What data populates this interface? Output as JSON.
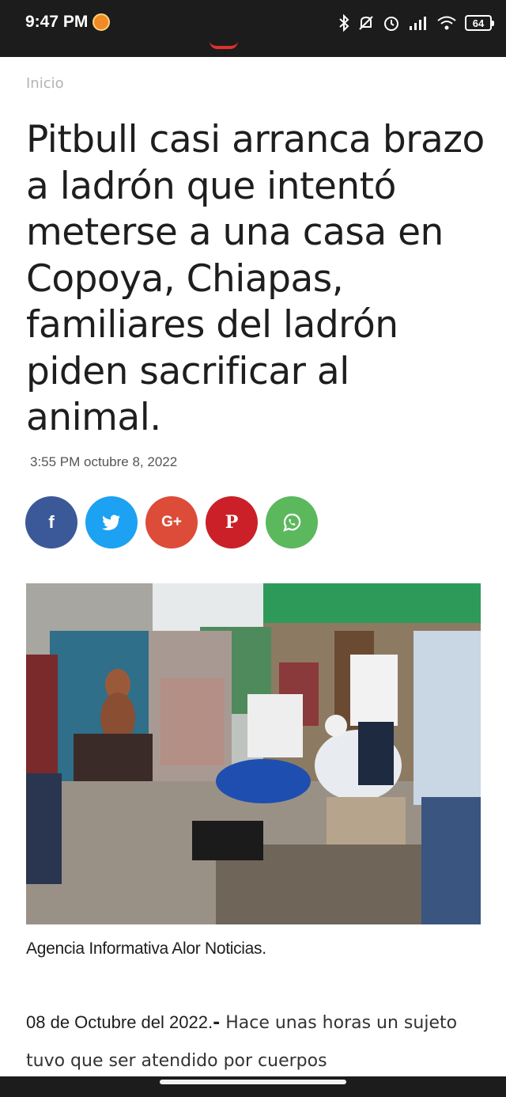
{
  "status_bar": {
    "time": "9:47 PM",
    "battery": "64",
    "icons": [
      "bluetooth-icon",
      "mute-icon",
      "alarm-icon",
      "signal-icon",
      "wifi-icon",
      "battery-icon"
    ]
  },
  "breadcrumb": "Inicio",
  "article": {
    "headline": "Pitbull casi arranca brazo a ladrón que intentó meterse a una casa en Copoya, Chiapas, familiares del ladrón piden sacrificar al animal.",
    "timestamp": "3:55 PM octubre 8, 2022",
    "caption": "Agencia Informativa Alor Noticias.",
    "date_lead": "08 de Octubre del 2022.",
    "date_sep": "-",
    "body_start": " Hace unas horas un sujeto tuvo que ser atendido por cuerpos"
  },
  "share": {
    "facebook": "f",
    "twitter": "twitter-icon",
    "google_plus": "G+",
    "pinterest": "P",
    "whatsapp": "whatsapp-icon",
    "colors": {
      "facebook": "#3b5998",
      "twitter": "#1da1f2",
      "google_plus": "#dd4b39",
      "pinterest": "#cb2027",
      "whatsapp": "#5cb85c"
    }
  }
}
